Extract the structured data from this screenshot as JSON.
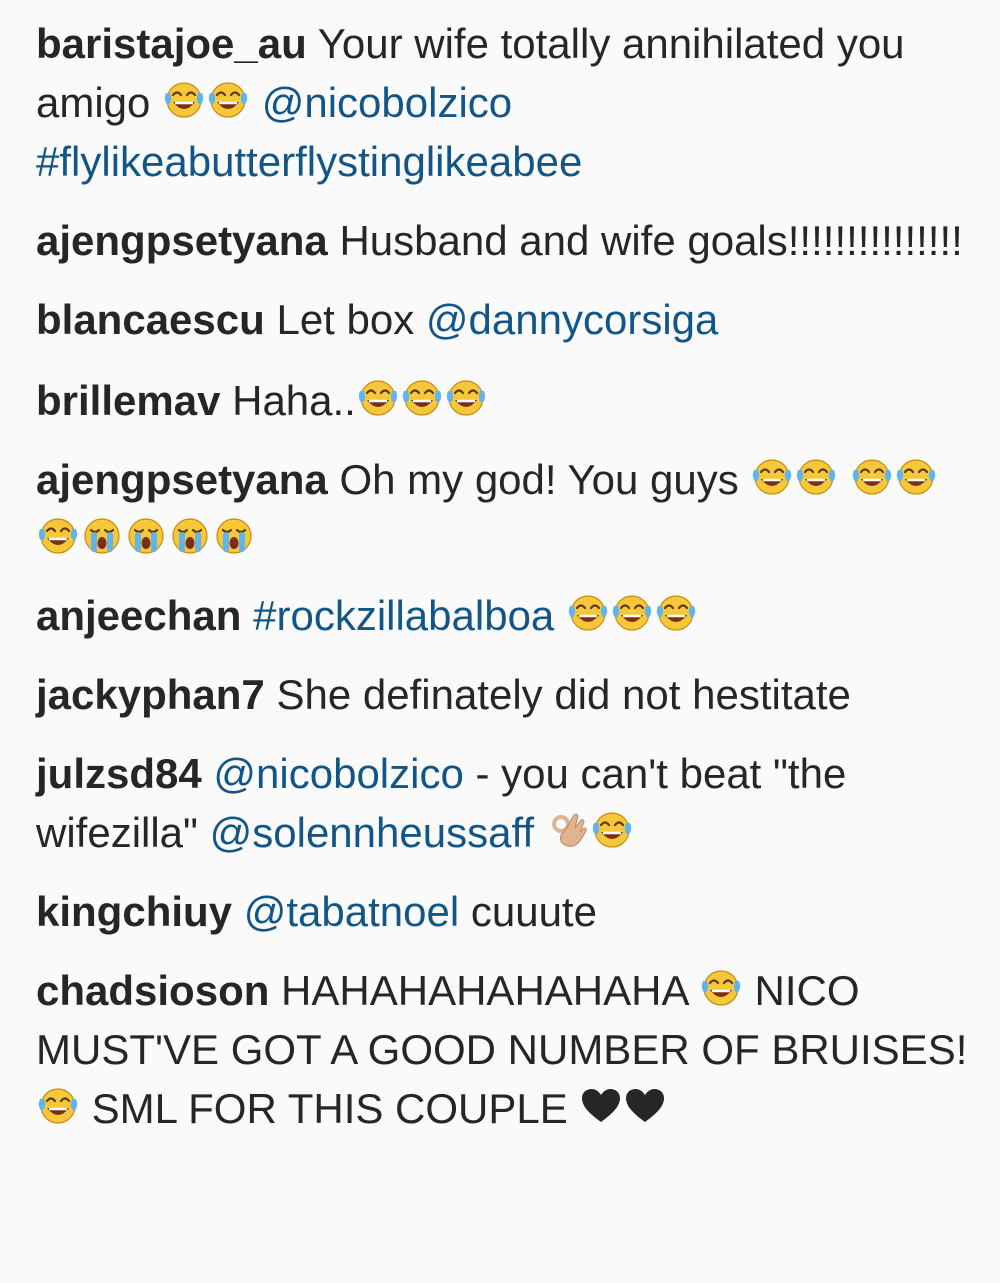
{
  "comments": [
    {
      "username": "baristajoe_au",
      "segments": [
        {
          "type": "text",
          "value": " Your wife totally annihilated you amigo "
        },
        {
          "type": "emoji",
          "value": "laugh-cry"
        },
        {
          "type": "emoji",
          "value": "laugh-cry"
        },
        {
          "type": "text",
          "value": " "
        },
        {
          "type": "mention",
          "value": "@nicobolzico"
        },
        {
          "type": "text",
          "value": " "
        },
        {
          "type": "hashtag",
          "value": "#flylikeabutterflystinglikeabee"
        }
      ]
    },
    {
      "username": "ajengpsetyana",
      "segments": [
        {
          "type": "text",
          "value": " Husband and wife goals!!!!!!!!!!!!!!!"
        }
      ]
    },
    {
      "username": "blancaescu",
      "segments": [
        {
          "type": "text",
          "value": " Let box "
        },
        {
          "type": "mention",
          "value": "@dannycorsiga"
        }
      ]
    },
    {
      "username": "brillemav",
      "segments": [
        {
          "type": "text",
          "value": " Haha.."
        },
        {
          "type": "emoji",
          "value": "laugh-cry"
        },
        {
          "type": "emoji",
          "value": "laugh-cry"
        },
        {
          "type": "emoji",
          "value": "laugh-cry"
        }
      ]
    },
    {
      "username": "ajengpsetyana",
      "segments": [
        {
          "type": "text",
          "value": " Oh my god! You guys "
        },
        {
          "type": "emoji",
          "value": "laugh-cry"
        },
        {
          "type": "emoji",
          "value": "laugh-cry"
        },
        {
          "type": "text",
          "value": " "
        },
        {
          "type": "emoji",
          "value": "laugh-cry"
        },
        {
          "type": "emoji",
          "value": "laugh-cry"
        },
        {
          "type": "emoji",
          "value": "laugh-cry"
        },
        {
          "type": "emoji",
          "value": "loud-cry"
        },
        {
          "type": "emoji",
          "value": "loud-cry"
        },
        {
          "type": "emoji",
          "value": "loud-cry"
        },
        {
          "type": "emoji",
          "value": "loud-cry"
        }
      ]
    },
    {
      "username": "anjeechan",
      "segments": [
        {
          "type": "text",
          "value": " "
        },
        {
          "type": "hashtag",
          "value": "#rockzillabalboa"
        },
        {
          "type": "text",
          "value": " "
        },
        {
          "type": "emoji",
          "value": "laugh-cry"
        },
        {
          "type": "emoji",
          "value": "laugh-cry"
        },
        {
          "type": "emoji",
          "value": "laugh-cry"
        }
      ]
    },
    {
      "username": "jackyphan7",
      "segments": [
        {
          "type": "text",
          "value": " She definately did not hestitate"
        }
      ]
    },
    {
      "username": "julzsd84",
      "segments": [
        {
          "type": "text",
          "value": " "
        },
        {
          "type": "mention",
          "value": "@nicobolzico"
        },
        {
          "type": "text",
          "value": " - you can't beat \"the wifezilla\" "
        },
        {
          "type": "mention",
          "value": "@solennheussaff"
        },
        {
          "type": "text",
          "value": " "
        },
        {
          "type": "emoji",
          "value": "ok-hand"
        },
        {
          "type": "emoji",
          "value": "laugh-cry"
        }
      ]
    },
    {
      "username": "kingchiuy",
      "segments": [
        {
          "type": "text",
          "value": " "
        },
        {
          "type": "mention",
          "value": "@tabatnoel"
        },
        {
          "type": "text",
          "value": " cuuute"
        }
      ]
    },
    {
      "username": "chadsioson",
      "segments": [
        {
          "type": "text",
          "value": " HAHAHAHAHAHAHA "
        },
        {
          "type": "emoji",
          "value": "laugh-cry"
        },
        {
          "type": "text",
          "value": " NICO MUST'VE GOT A GOOD NUMBER OF BRUISES! "
        },
        {
          "type": "emoji",
          "value": "laugh-cry"
        },
        {
          "type": "text",
          "value": " SML FOR THIS COUPLE "
        },
        {
          "type": "emoji",
          "value": "heart"
        },
        {
          "type": "emoji",
          "value": "heart"
        }
      ]
    }
  ],
  "colors": {
    "background": "#fafafa",
    "text": "#262626",
    "link": "#125688"
  }
}
